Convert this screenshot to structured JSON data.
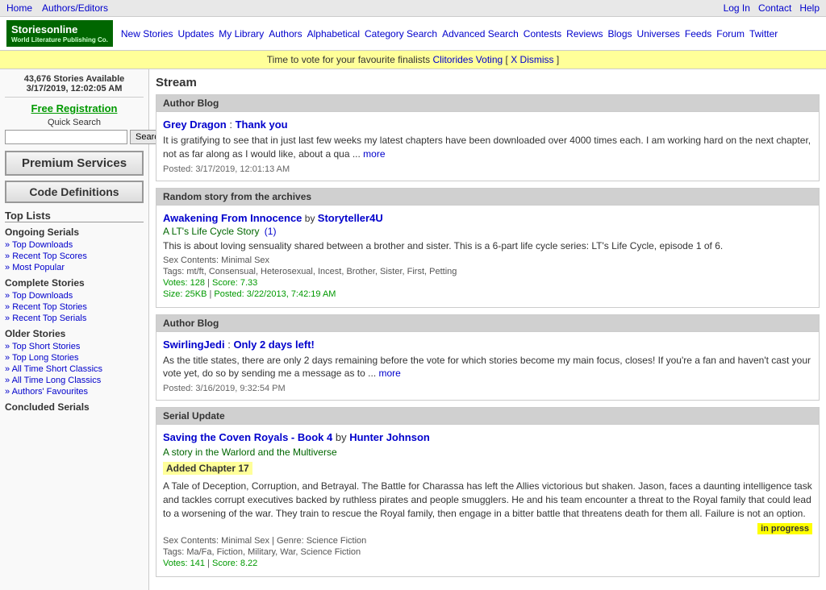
{
  "topNav": {
    "links": [
      "Home",
      "Authors/Editors"
    ],
    "rightLinks": [
      "Log In",
      "Contact",
      "Help"
    ]
  },
  "logo": {
    "siteName": "Storiesonline",
    "tagline": "World Literature Publishing Co."
  },
  "mainNav": {
    "links": [
      "New Stories",
      "Updates",
      "My Library",
      "Authors",
      "Alphabetical",
      "Category Search",
      "Advanced Search",
      "Contests",
      "Reviews",
      "Blogs",
      "Universes",
      "Feeds",
      "Forum",
      "Twitter"
    ]
  },
  "banner": {
    "text": "Time to vote for your favourite finalists",
    "linkText": "Clitorides Voting",
    "dismissText": "X Dismiss"
  },
  "sidebar": {
    "statsLine1": "43,676 Stories Available",
    "statsLine2": "3/17/2019, 12:02:05 AM",
    "freeReg": "Free Registration",
    "quickSearchLabel": "Quick Search",
    "searchPlaceholder": "",
    "searchButton": "Search",
    "premiumServices": "Premium Services",
    "codeDefinitions": "Code Definitions",
    "topLists": "Top Lists",
    "ongoingSerials": "Ongoing Serials",
    "ongoingLinks": [
      "Top Downloads",
      "Recent Top Scores",
      "Most Popular"
    ],
    "completeStories": "Complete Stories",
    "completeLinks": [
      "Top Downloads",
      "Recent Top Stories",
      "Recent Top Serials"
    ],
    "olderStories": "Older Stories",
    "olderLinks": [
      "Top Short Stories",
      "Top Long Stories",
      "All Time Short Classics",
      "All Time Long Classics",
      "Authors' Favourites"
    ],
    "concludedSerials": "Concluded Serials"
  },
  "main": {
    "streamTitle": "Stream",
    "sections": [
      {
        "type": "author-blog",
        "header": "Author Blog",
        "authorName": "Grey Dragon",
        "titleLink": "Thank you",
        "text": "It is gratifying to see that in just last few weeks my latest chapters have been downloaded over 4000 times each. I am working hard on the next chapter, not as far along as I would like, about a qua ...",
        "moreText": "more",
        "date": "Posted: 3/17/2019, 12:01:13 AM"
      },
      {
        "type": "random-story",
        "header": "Random story from the archives",
        "storyTitle": "Awakening From Innocence",
        "storyBy": "by",
        "storyAuthor": "Storyteller4U",
        "subtitle": "A LT's Life Cycle Story",
        "subtitleBadge": "(1)",
        "desc": "This is about loving sensuality shared between a brother and sister. This is a 6-part life cycle series: LT's Life Cycle, episode 1 of 6.",
        "sexContents": "Sex Contents: Minimal Sex",
        "tags": "Tags: mt/ft, Consensual, Heterosexual, Incest, Brother, Sister, First, Petting",
        "votes": "Votes: 128",
        "score": "Score: 7.33",
        "size": "Size: 25KB",
        "posted": "Posted: 3/22/2013, 7:42:19 AM"
      },
      {
        "type": "author-blog",
        "header": "Author Blog",
        "authorName": "SwirlingJedi",
        "titleLink": "Only 2 days left!",
        "text": "As the title states, there are only 2 days remaining before the vote for which stories become my main focus, closes! If you're a fan and haven't cast your vote yet, do so by sending me a message as to ...",
        "moreText": "more",
        "date": "Posted: 3/16/2019, 9:32:54 PM"
      },
      {
        "type": "serial-update",
        "header": "Serial Update",
        "storyTitle": "Saving the Coven Royals - Book 4",
        "storyBy": "by",
        "storyAuthor": "Hunter Johnson",
        "subtitle": "A story in the Warlord and the Multiverse",
        "addedChapter": "Added Chapter 17",
        "desc": "A Tale of Deception, Corruption, and Betrayal. The Battle for Charassa has left the Allies victorious but shaken. Jason, faces a daunting intelligence task and tackles corrupt executives backed by ruthless pirates and people smugglers. He and his team encounter a threat to the Royal family that could lead to a worsening of the war. They train to rescue the Royal family, then engage in a bitter battle that threatens death for them all. Failure is not an option.",
        "badge": "in progress",
        "sexContents": "Sex Contents: Minimal Sex | Genre: Science Fiction",
        "tags": "Tags: Ma/Fa, Fiction, Military, War, Science Fiction",
        "votes": "Votes: 141",
        "score": "Score: 8.22"
      }
    ]
  }
}
